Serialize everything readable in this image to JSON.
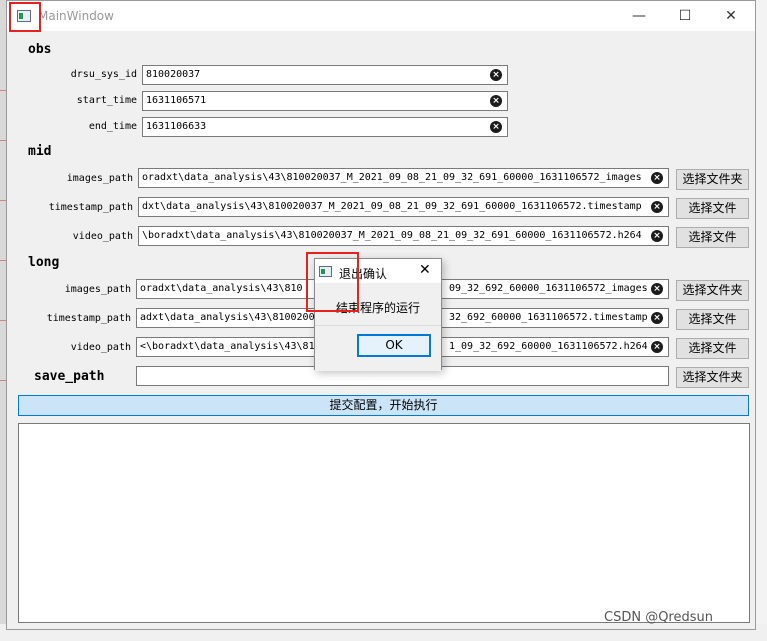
{
  "window": {
    "title": "MainWindow",
    "minimize": "—",
    "maximize": "☐",
    "close": "✕"
  },
  "sections": {
    "obs": "obs",
    "mid": "mid",
    "long": "long"
  },
  "obs": {
    "drsu_sys_id": {
      "label": "drsu_sys_id",
      "value": "810020037"
    },
    "start_time": {
      "label": "start_time",
      "value": "1631106571"
    },
    "end_time": {
      "label": "end_time",
      "value": "1631106633"
    }
  },
  "mid": {
    "images_path": {
      "label": "images_path",
      "value": "oradxt\\data_analysis\\43\\810020037_M_2021_09_08_21_09_32_691_60000_1631106572_images",
      "button": "选择文件夹"
    },
    "timestamp_path": {
      "label": "timestamp_path",
      "value": "dxt\\data_analysis\\43\\810020037_M_2021_09_08_21_09_32_691_60000_1631106572.timestamp",
      "button": "选择文件"
    },
    "video_path": {
      "label": "video_path",
      "value": "\\boradxt\\data_analysis\\43\\810020037_M_2021_09_08_21_09_32_691_60000_1631106572.h264",
      "button": "选择文件"
    }
  },
  "long": {
    "images_path": {
      "label": "images_path",
      "value_left": "oradxt\\data_analysis\\43\\810",
      "value_right": "09_32_692_60000_1631106572_images",
      "button": "选择文件夹"
    },
    "timestamp_path": {
      "label": "timestamp_path",
      "value_left": "adxt\\data_analysis\\43\\81002003",
      "value_right": "32_692_60000_1631106572.timestamp",
      "button": "选择文件"
    },
    "video_path": {
      "label": "video_path",
      "value_left": "<\\boradxt\\data_analysis\\43\\810",
      "value_right": "1_09_32_692_60000_1631106572.h264",
      "button": "选择文件"
    }
  },
  "save_path": {
    "label": "save_path",
    "value": "",
    "button": "选择文件夹"
  },
  "submit_label": "提交配置，开始执行",
  "dialog": {
    "title": "退出确认",
    "message": "结束程序的运行",
    "ok": "OK",
    "close": "✕"
  },
  "watermark": "CSDN @Qredsun",
  "colors": {
    "highlight": "#e8211f",
    "accent": "#0078d7",
    "submit_bg": "#cce4f7"
  }
}
